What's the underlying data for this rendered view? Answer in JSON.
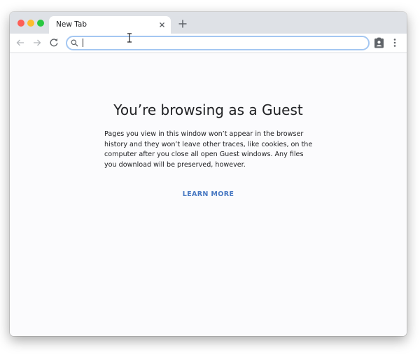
{
  "tab": {
    "title": "New Tab"
  },
  "omnibox": {
    "value": "",
    "placeholder": ""
  },
  "page": {
    "heading": "You’re browsing as a Guest",
    "description": "Pages you view in this window won’t appear in the browser history and they won’t leave other traces, like cookies, on the computer after you close all open Guest windows. Any files you download will be preserved, however.",
    "learn_more": "LEARN MORE"
  },
  "colors": {
    "tabstrip": "#dee1e6",
    "close_light": "#fd5f57",
    "minimize_light": "#fdbc2e",
    "maximize_light": "#28c840",
    "omnibox_focus": "#a4c7f2",
    "link": "#4a7ac3",
    "content_bg": "#fbfbfd"
  },
  "icons": {
    "tab_close": "close-icon",
    "new_tab": "plus-icon",
    "back": "arrow-left-icon",
    "forward": "arrow-right-icon",
    "reload": "reload-icon",
    "search": "search-icon",
    "profile": "guest-profile-icon",
    "menu": "more-vert-icon"
  }
}
